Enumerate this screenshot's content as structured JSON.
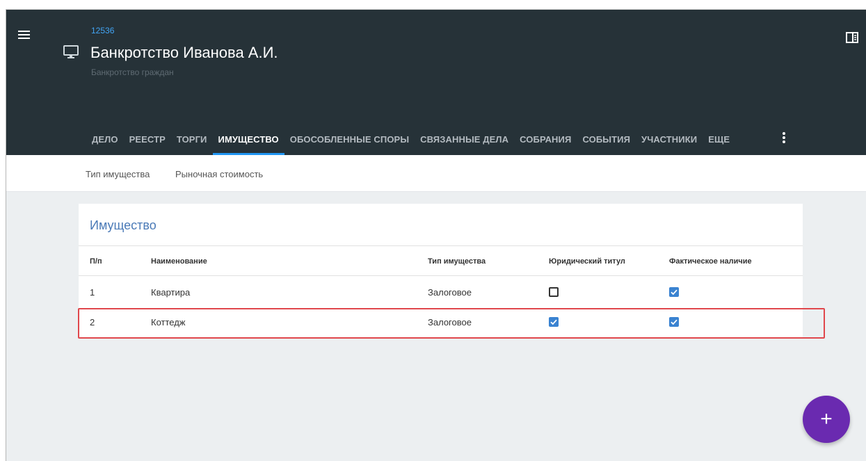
{
  "header": {
    "case_number": "12536",
    "title": "Банкротство Иванова А.И.",
    "subtitle": "Банкротство граждан",
    "menu_icon": "hamburger-menu-icon",
    "case_icon": "monitor-icon",
    "panel_icon": "side-panel-icon",
    "background_color": "#263238",
    "accent_color": "#2196f3"
  },
  "tabs": [
    {
      "label": "ДЕЛО",
      "active": false
    },
    {
      "label": "РЕЕСТР",
      "active": false
    },
    {
      "label": "ТОРГИ",
      "active": false
    },
    {
      "label": "ИМУЩЕСТВО",
      "active": true
    },
    {
      "label": "ОБОСОБЛЕННЫЕ СПОРЫ",
      "active": false
    },
    {
      "label": "СВЯЗАННЫЕ ДЕЛА",
      "active": false
    },
    {
      "label": "СОБРАНИЯ",
      "active": false
    },
    {
      "label": "СОБЫТИЯ",
      "active": false
    },
    {
      "label": "УЧАСТНИКИ",
      "active": false
    },
    {
      "label": "ЕЩЕ",
      "active": false
    }
  ],
  "subtabs": [
    {
      "label": "Тип имущества"
    },
    {
      "label": "Рыночная стоимость"
    }
  ],
  "card": {
    "title": "Имущество",
    "columns": [
      "П/п",
      "Наименование",
      "Тип имущества",
      "Юридический титул",
      "Фактическое наличие"
    ],
    "rows": [
      {
        "num": "1",
        "name": "Квартира",
        "type": "Залоговое",
        "legal_title": false,
        "actual_presence": true
      },
      {
        "num": "2",
        "name": "Коттедж",
        "type": "Залоговое",
        "legal_title": true,
        "actual_presence": true
      }
    ],
    "highlighted_row": "2",
    "checkbox_color": "#3a83d1",
    "highlight_color": "#e0474c"
  },
  "fab": {
    "label": "+",
    "color": "#6a2ab0"
  }
}
